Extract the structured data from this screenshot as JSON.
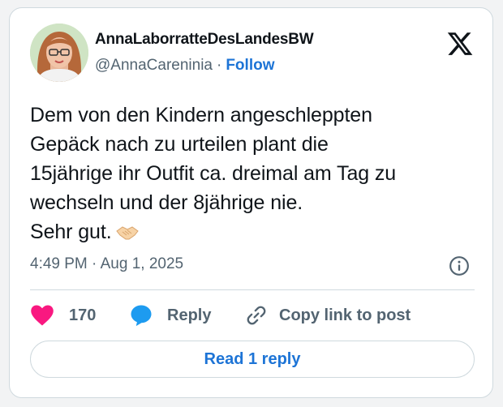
{
  "user": {
    "display_name": "AnnaLaborratteDesLandesBW",
    "handle": "@AnnaCareninia",
    "separator": "·",
    "follow_label": "Follow"
  },
  "tweet": {
    "lines": [
      "Dem von den Kindern angeschleppten",
      "Gepäck nach zu urteilen plant die",
      "15jährige ihr Outfit ca. dreimal am Tag zu",
      "wechseln und der 8jährige nie."
    ],
    "last_line": "Sehr gut.",
    "emoji": "handshake-icon",
    "time": "4:49 PM",
    "separator": "·",
    "date": "Aug 1, 2025"
  },
  "actions": {
    "like_count": "170",
    "reply_label": "Reply",
    "copy_label": "Copy link to post"
  },
  "read_reply_label": "Read 1 reply",
  "colors": {
    "like": "#f91880",
    "reply": "#1d9bf0",
    "link": "#1d74d6",
    "muted": "#536471",
    "text": "#0f1419",
    "border": "#cfd9de"
  }
}
